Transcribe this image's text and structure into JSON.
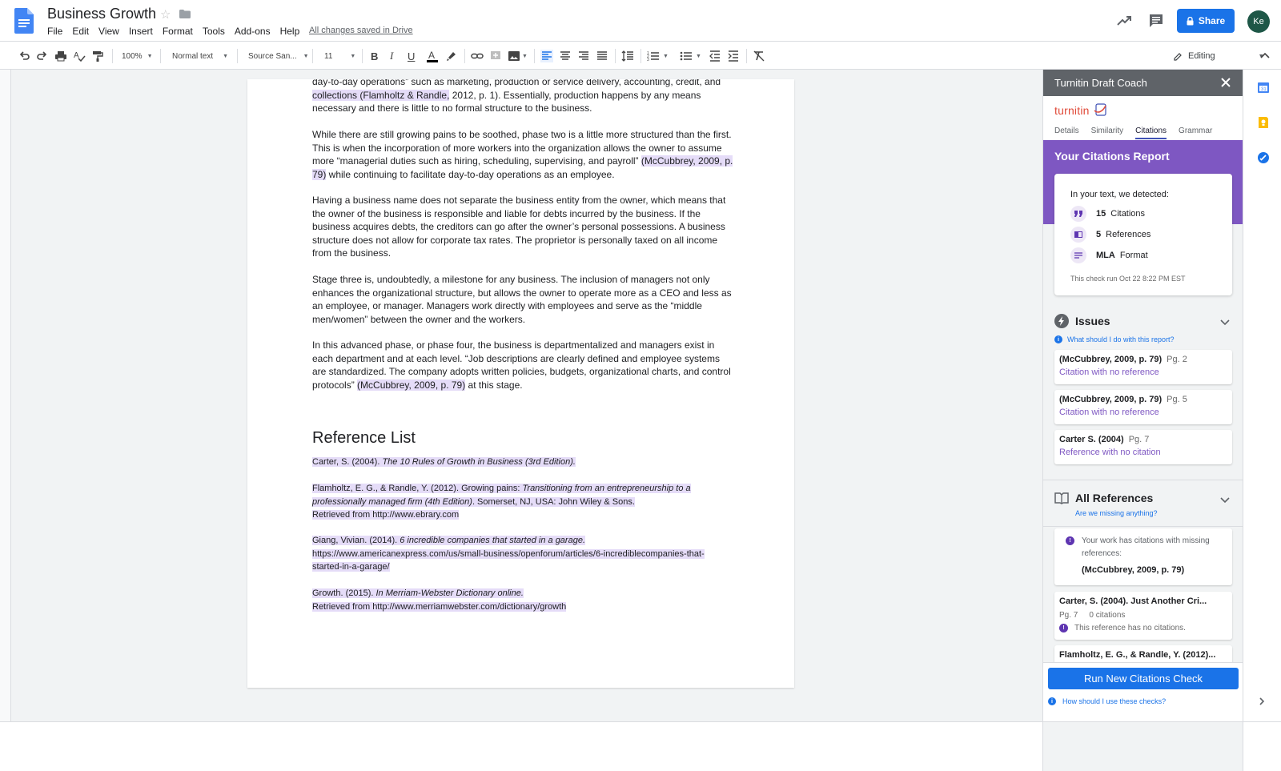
{
  "doc": {
    "title": "Business Growth",
    "saved_status": "All changes saved in Drive",
    "menu": [
      "File",
      "Edit",
      "View",
      "Insert",
      "Format",
      "Tools",
      "Add-ons",
      "Help"
    ]
  },
  "header": {
    "share_label": "Share",
    "avatar_initials": "Ke"
  },
  "toolbar": {
    "zoom": "100%",
    "style": "Normal text",
    "font": "Source San...",
    "size": "11",
    "mode": "Editing"
  },
  "document": {
    "para1": {
      "line1": "day-to-day operations” such as marketing, production or service delivery, accounting, credit, and",
      "cite": "collections (Flamholtz & Randle,",
      "rest": " 2012, p. 1). Essentially, production happens by any means necessary and there is little to no formal structure to the business."
    },
    "para2": {
      "text": "While there are still growing pains to be soothed, phase two is a little more structured than the first. This is when the incorporation of more workers into the organization allows the owner to assume more “managerial duties such as hiring, scheduling, supervising, and payroll” ",
      "cite": "(McCubbrey, 2009, p. 79)",
      "rest": " while continuing to facilitate day-to-day operations as an employee."
    },
    "para3": "Having a business name does not separate the business entity from the owner, which means that the owner of the business is responsible and liable for debts incurred by the business. If the business acquires debts, the creditors can go after the owner’s personal possessions. A business structure does not allow for corporate tax rates. The proprietor is personally taxed on all income from the business.",
    "para4": "Stage three is, undoubtedly, a milestone for any business. The inclusion of managers not only enhances the organizational structure, but allows the owner to operate more as a CEO and less as an employee, or manager. Managers work directly with employees and serve as the “middle men/women” between the owner and the workers.",
    "para5": {
      "text": "In this advanced phase, or phase four, the business is departmentalized and managers exist in each department and at each level. “Job descriptions are clearly defined and employee systems are standardized. The company adopts written policies, budgets, organizational charts, and control protocols” ",
      "cite": "(McCubbrey, 2009, p. 79)",
      "rest": " at this stage."
    },
    "ref_heading": "Reference List",
    "refs": {
      "r1": {
        "a": "Carter, S. (2004). ",
        "b": "The 10 Rules of Growth in Business (3rd Edition)."
      },
      "r2": {
        "a": "Flamholtz, E. G., & Randle, Y. (2012). Growing pains: ",
        "b": "Transitioning from an entrepreneurship to a professionally managed firm (4th Edition)",
        "c": ". Somerset, NJ, USA: John Wiley & Sons.",
        "d": "Retrieved from http://www.ebrary.com"
      },
      "r3": {
        "a": "Giang, Vivian. (2014). ",
        "b": "6 incredible companies that started in a garage.",
        "c": "https://www.americanexpress.com/us/small-business/openforum/articles/6-incrediblecompanies-that-started-in-a-garage/"
      },
      "r4": {
        "a": "Growth. (2015). ",
        "b": "In Merriam-Webster Dictionary online.",
        "c": "Retrieved from http://www.merriamwebster.com/dictionary/growth"
      }
    }
  },
  "sidebar": {
    "title": "Turnitin Draft Coach",
    "logo": "turnitin",
    "tabs": [
      "Details",
      "Similarity",
      "Citations",
      "Grammar"
    ],
    "report_title": "Your Citations Report",
    "detected_intro": "In your text, we detected:",
    "stats": [
      {
        "num": "15",
        "label": "Citations"
      },
      {
        "num": "5",
        "label": "References"
      },
      {
        "num": "MLA",
        "label": "Format"
      }
    ],
    "run_time": "This check run Oct 22 8:22 PM EST",
    "issues_title": "Issues",
    "issues_link": "What should I do with this report?",
    "issues": [
      {
        "cite": "(McCubbrey, 2009, p. 79)",
        "page": "Pg. 2",
        "label": "Citation with no reference"
      },
      {
        "cite": "(McCubbrey, 2009, p. 79)",
        "page": "Pg. 5",
        "label": "Citation with no reference"
      },
      {
        "cite": "Carter S. (2004)",
        "page": "Pg. 7",
        "label": "Reference with no citation"
      }
    ],
    "refs_title": "All References",
    "refs_link": "Are we missing anything?",
    "warning_text": "Your work has citations with missing references:",
    "warning_cite": "(McCubbrey, 2009, p. 79)",
    "ref_items": [
      {
        "name": "Carter, S. (2004). Just Another Cri...",
        "page": "Pg. 7",
        "count": "0 citations",
        "note": "This reference has no citations."
      },
      {
        "name": "Flamholtz, E. G., & Randle, Y. (2012)..."
      }
    ],
    "run_button": "Run New Citations Check",
    "foot_link": "How should I use these checks?"
  },
  "colors": {
    "accent": "#1a73e8",
    "turnitin_purple": "#7e57c2",
    "highlight": "#e5dcf8"
  }
}
